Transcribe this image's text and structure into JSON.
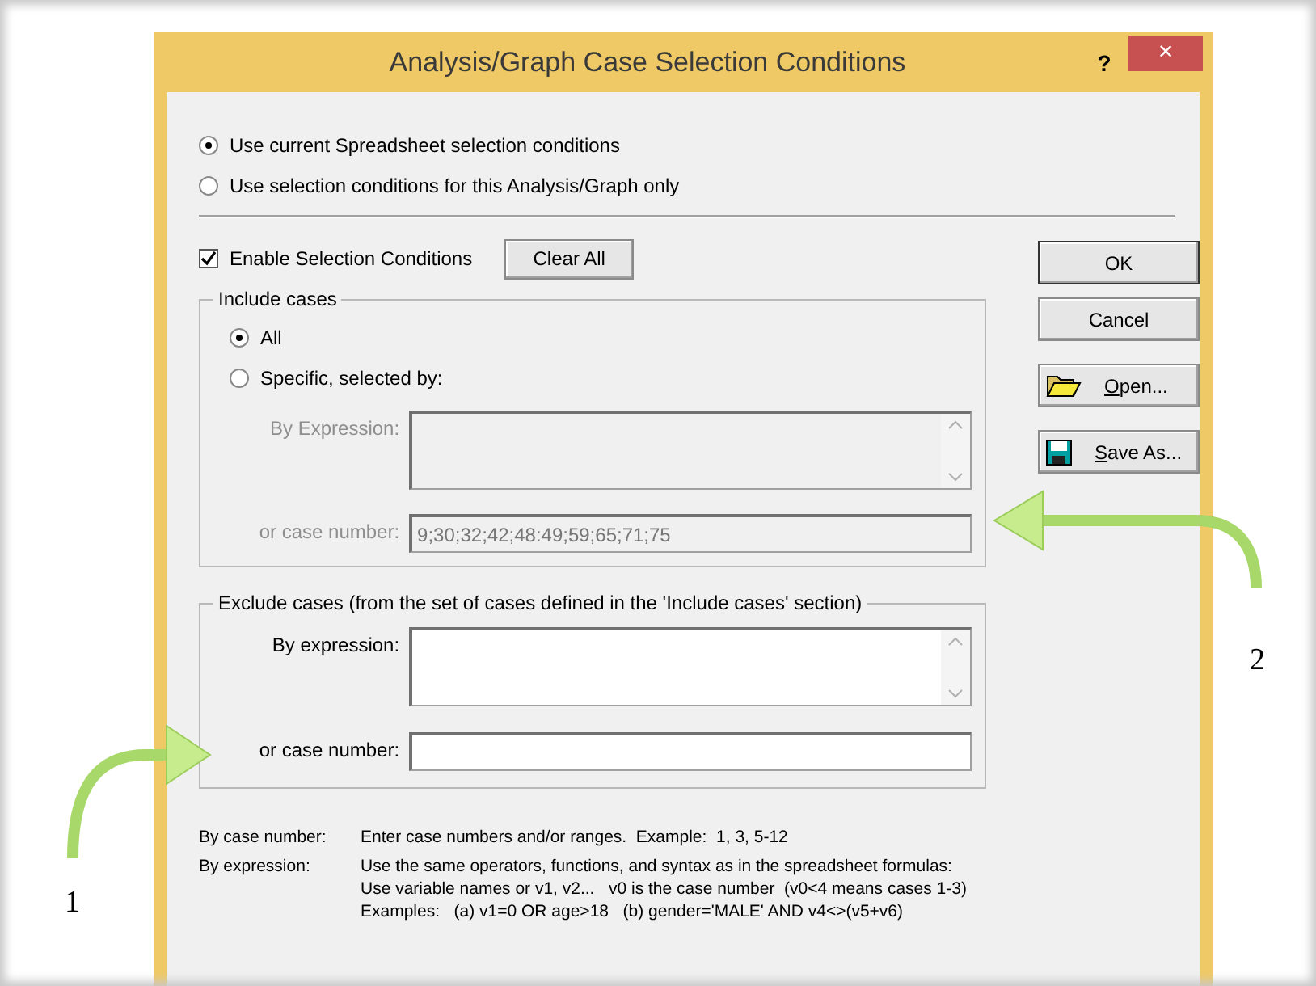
{
  "window": {
    "title": "Analysis/Graph Case Selection Conditions",
    "help": "?",
    "close": "×"
  },
  "scope_options": [
    {
      "label": "Use current Spreadsheet selection conditions",
      "selected": true
    },
    {
      "label": "Use selection conditions for this Analysis/Graph only",
      "selected": false
    }
  ],
  "enable_selection": {
    "label": "Enable Selection Conditions",
    "checked": true
  },
  "clear_all_button": "Clear All",
  "include_cases": {
    "title": "Include cases",
    "options": [
      {
        "label": "All",
        "selected": true
      },
      {
        "label": "Specific, selected by:",
        "selected": false
      }
    ],
    "disabled": true,
    "expression_label": "By Expression:",
    "case_number_label": "or case number:",
    "case_number_value": "9;30;32;42;48:49;59;65;71;75"
  },
  "exclude_cases": {
    "title": "Exclude cases (from the set of cases defined in the 'Include cases' section)",
    "expression_label": "By expression:",
    "case_number_label": "or case number:"
  },
  "buttons": [
    {
      "label": "OK",
      "kind": "default"
    },
    {
      "label": "Cancel",
      "kind": "plain"
    },
    {
      "underlined_letter": "O",
      "label_rest": "pen...",
      "kind": "open"
    },
    {
      "underlined_letter": "S",
      "label_rest": "ave As...",
      "kind": "save"
    }
  ],
  "notes": [
    {
      "term": "By case number:",
      "lines": [
        "Enter case numbers and/or ranges.  Example:  1, 3, 5-12"
      ]
    },
    {
      "term": "By expression:",
      "lines": [
        "Use the same operators, functions, and syntax as in the spreadsheet formulas:",
        "Use variable names or v1, v2...   v0 is the case number  (v0<4 means cases 1-3)",
        "Examples:   (a) v1=0 OR age>18   (b) gender='MALE' AND v4<>(v5+v6)"
      ]
    }
  ],
  "callouts": [
    {
      "label": "2",
      "kind": "right"
    },
    {
      "label": "1",
      "kind": "left"
    }
  ]
}
